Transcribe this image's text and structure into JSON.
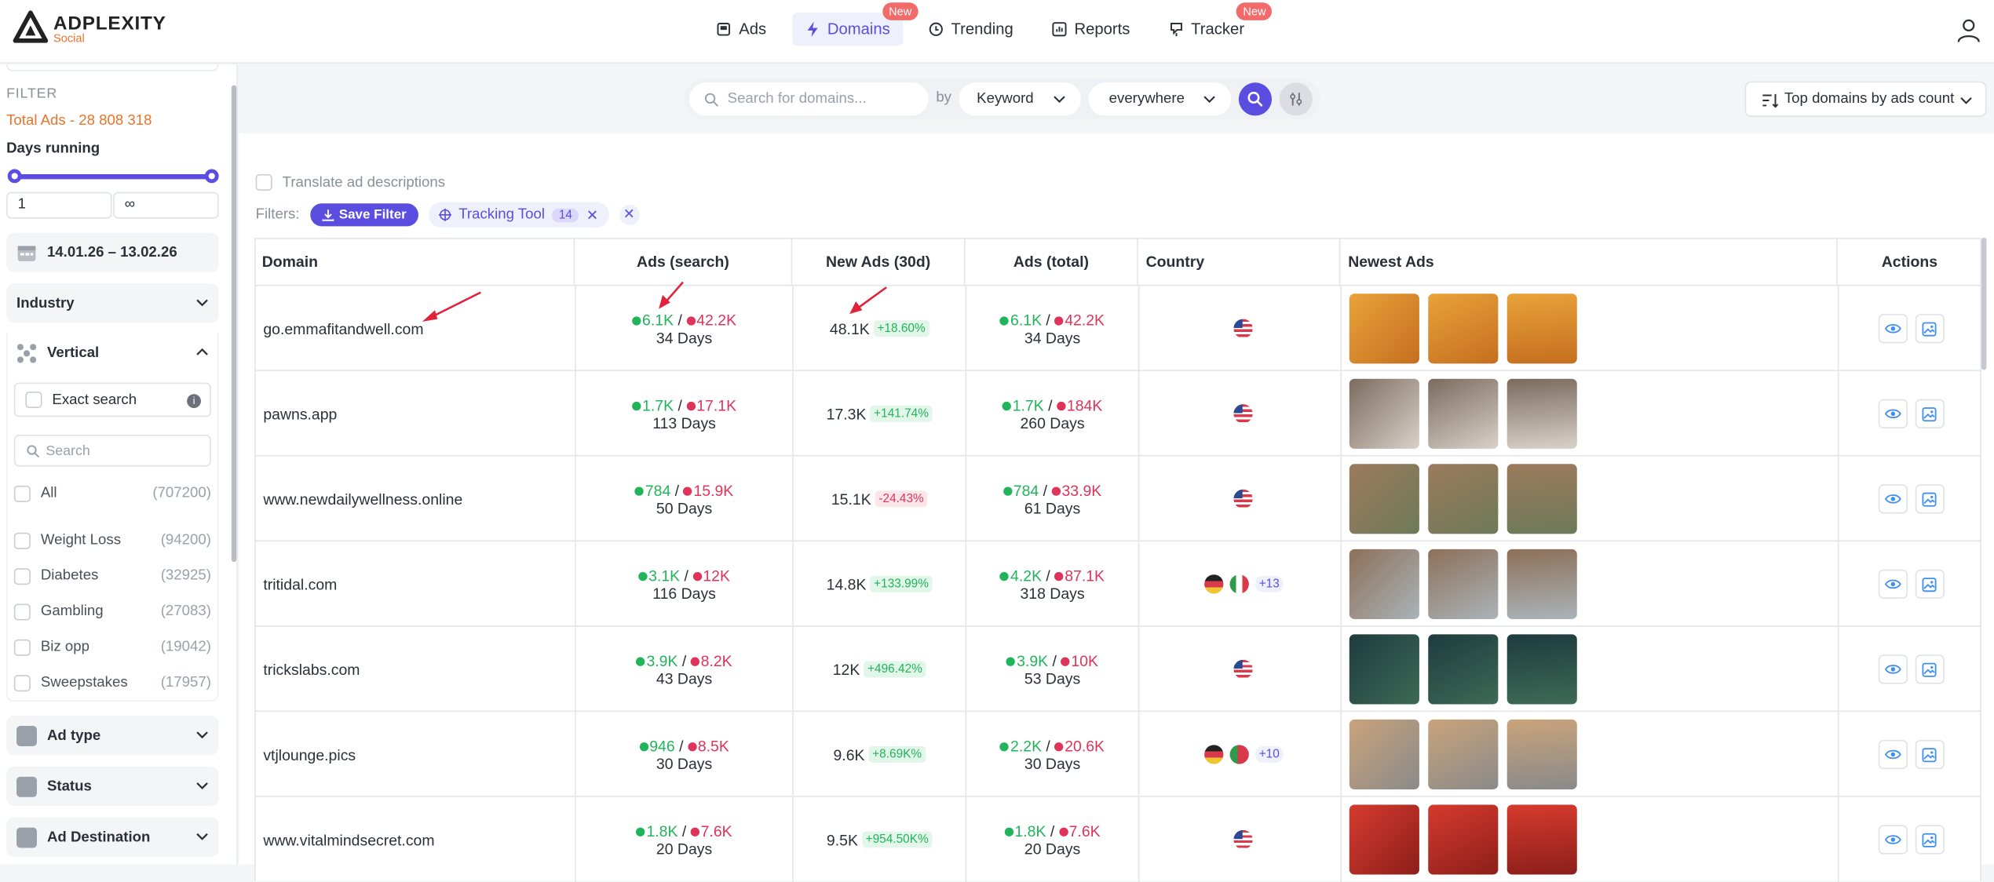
{
  "brand": {
    "name": "ADPLEXITY",
    "sub": "Social"
  },
  "nav": [
    {
      "label": "Ads",
      "new": false
    },
    {
      "label": "Domains",
      "new": true,
      "active": true
    },
    {
      "label": "Trending",
      "new": false
    },
    {
      "label": "Reports",
      "new": false
    },
    {
      "label": "Tracker",
      "new": true
    }
  ],
  "new_badge": "New",
  "sidebar": {
    "filter_label": "FILTER",
    "total_ads": "Total Ads - 28 808 318",
    "days_running": "Days running",
    "days_min": "1",
    "days_max": "∞",
    "date_range": "14.01.26 – 13.02.26",
    "industry": "Industry",
    "vertical": "Vertical",
    "exact_search": "Exact search",
    "search_placeholder": "Search",
    "vertical_items": [
      {
        "label": "All",
        "count": "(707200)"
      },
      {
        "label": "Weight Loss",
        "count": "(94200)"
      },
      {
        "label": "Diabetes",
        "count": "(32925)"
      },
      {
        "label": "Gambling",
        "count": "(27083)"
      },
      {
        "label": "Biz opp",
        "count": "(19042)"
      },
      {
        "label": "Sweepstakes",
        "count": "(17957)"
      }
    ],
    "ad_type": "Ad type",
    "status": "Status",
    "ad_destination": "Ad Destination"
  },
  "search": {
    "placeholder": "Search for domains...",
    "by": "by",
    "keyword": "Keyword",
    "scope": "everywhere"
  },
  "sort": "Top domains by ads count",
  "translate": "Translate ad descriptions",
  "filters": {
    "label": "Filters:",
    "save": "Save Filter",
    "chip": "Tracking Tool",
    "chip_count": "14"
  },
  "table": {
    "headers": [
      "Domain",
      "Ads (search)",
      "New Ads (30d)",
      "Ads (total)",
      "Country",
      "Newest Ads",
      "Actions"
    ],
    "rows": [
      {
        "domain": "go.emmafitandwell.com",
        "s_g": "6.1K",
        "s_r": "42.2K",
        "s_days": "34 Days",
        "new": "48.1K",
        "pct": "+18.60%",
        "dir": "up",
        "t_g": "6.1K",
        "t_r": "42.2K",
        "t_days": "34 Days",
        "flags": [
          "us"
        ],
        "more": ""
      },
      {
        "domain": "pawns.app",
        "s_g": "1.7K",
        "s_r": "17.1K",
        "s_days": "113 Days",
        "new": "17.3K",
        "pct": "+141.74%",
        "dir": "up",
        "t_g": "1.7K",
        "t_r": "184K",
        "t_days": "260 Days",
        "flags": [
          "us"
        ],
        "more": ""
      },
      {
        "domain": "www.newdailywellness.online",
        "s_g": "784",
        "s_r": "15.9K",
        "s_days": "50 Days",
        "new": "15.1K",
        "pct": "-24.43%",
        "dir": "down",
        "t_g": "784",
        "t_r": "33.9K",
        "t_days": "61 Days",
        "flags": [
          "us"
        ],
        "more": ""
      },
      {
        "domain": "tritidal.com",
        "s_g": "3.1K",
        "s_r": "12K",
        "s_days": "116 Days",
        "new": "14.8K",
        "pct": "+133.99%",
        "dir": "up",
        "t_g": "4.2K",
        "t_r": "87.1K",
        "t_days": "318 Days",
        "flags": [
          "de",
          "it"
        ],
        "more": "+13"
      },
      {
        "domain": "trickslabs.com",
        "s_g": "3.9K",
        "s_r": "8.2K",
        "s_days": "43 Days",
        "new": "12K",
        "pct": "+496.42%",
        "dir": "up",
        "t_g": "3.9K",
        "t_r": "10K",
        "t_days": "53 Days",
        "flags": [
          "us"
        ],
        "more": ""
      },
      {
        "domain": "vtjlounge.pics",
        "s_g": "946",
        "s_r": "8.5K",
        "s_days": "30 Days",
        "new": "9.6K",
        "pct": "+8.69K%",
        "dir": "up",
        "t_g": "2.2K",
        "t_r": "20.6K",
        "t_days": "30 Days",
        "flags": [
          "de",
          "pt"
        ],
        "more": "+10"
      },
      {
        "domain": "www.vitalmindsecret.com",
        "s_g": "1.8K",
        "s_r": "7.6K",
        "s_days": "20 Days",
        "new": "9.5K",
        "pct": "+954.50K%",
        "dir": "up",
        "t_g": "1.8K",
        "t_r": "7.6K",
        "t_days": "20 Days",
        "flags": [
          "us"
        ],
        "more": ""
      }
    ]
  },
  "colors": {
    "accent": "#5b4de0",
    "green": "#22b45b",
    "red": "#e0335a",
    "orange": "#e8742a"
  }
}
